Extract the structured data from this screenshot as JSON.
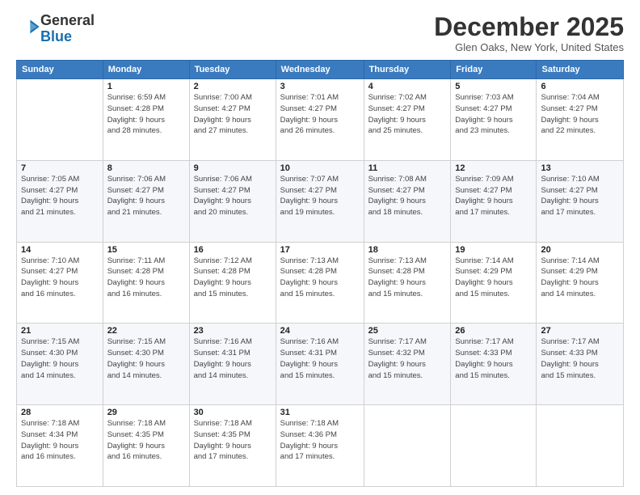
{
  "header": {
    "logo_line1": "General",
    "logo_line2": "Blue",
    "month_title": "December 2025",
    "location": "Glen Oaks, New York, United States"
  },
  "days_of_week": [
    "Sunday",
    "Monday",
    "Tuesday",
    "Wednesday",
    "Thursday",
    "Friday",
    "Saturday"
  ],
  "weeks": [
    [
      {
        "day": "",
        "info": ""
      },
      {
        "day": "1",
        "info": "Sunrise: 6:59 AM\nSunset: 4:28 PM\nDaylight: 9 hours\nand 28 minutes."
      },
      {
        "day": "2",
        "info": "Sunrise: 7:00 AM\nSunset: 4:27 PM\nDaylight: 9 hours\nand 27 minutes."
      },
      {
        "day": "3",
        "info": "Sunrise: 7:01 AM\nSunset: 4:27 PM\nDaylight: 9 hours\nand 26 minutes."
      },
      {
        "day": "4",
        "info": "Sunrise: 7:02 AM\nSunset: 4:27 PM\nDaylight: 9 hours\nand 25 minutes."
      },
      {
        "day": "5",
        "info": "Sunrise: 7:03 AM\nSunset: 4:27 PM\nDaylight: 9 hours\nand 23 minutes."
      },
      {
        "day": "6",
        "info": "Sunrise: 7:04 AM\nSunset: 4:27 PM\nDaylight: 9 hours\nand 22 minutes."
      }
    ],
    [
      {
        "day": "7",
        "info": "Sunrise: 7:05 AM\nSunset: 4:27 PM\nDaylight: 9 hours\nand 21 minutes."
      },
      {
        "day": "8",
        "info": "Sunrise: 7:06 AM\nSunset: 4:27 PM\nDaylight: 9 hours\nand 21 minutes."
      },
      {
        "day": "9",
        "info": "Sunrise: 7:06 AM\nSunset: 4:27 PM\nDaylight: 9 hours\nand 20 minutes."
      },
      {
        "day": "10",
        "info": "Sunrise: 7:07 AM\nSunset: 4:27 PM\nDaylight: 9 hours\nand 19 minutes."
      },
      {
        "day": "11",
        "info": "Sunrise: 7:08 AM\nSunset: 4:27 PM\nDaylight: 9 hours\nand 18 minutes."
      },
      {
        "day": "12",
        "info": "Sunrise: 7:09 AM\nSunset: 4:27 PM\nDaylight: 9 hours\nand 17 minutes."
      },
      {
        "day": "13",
        "info": "Sunrise: 7:10 AM\nSunset: 4:27 PM\nDaylight: 9 hours\nand 17 minutes."
      }
    ],
    [
      {
        "day": "14",
        "info": "Sunrise: 7:10 AM\nSunset: 4:27 PM\nDaylight: 9 hours\nand 16 minutes."
      },
      {
        "day": "15",
        "info": "Sunrise: 7:11 AM\nSunset: 4:28 PM\nDaylight: 9 hours\nand 16 minutes."
      },
      {
        "day": "16",
        "info": "Sunrise: 7:12 AM\nSunset: 4:28 PM\nDaylight: 9 hours\nand 15 minutes."
      },
      {
        "day": "17",
        "info": "Sunrise: 7:13 AM\nSunset: 4:28 PM\nDaylight: 9 hours\nand 15 minutes."
      },
      {
        "day": "18",
        "info": "Sunrise: 7:13 AM\nSunset: 4:28 PM\nDaylight: 9 hours\nand 15 minutes."
      },
      {
        "day": "19",
        "info": "Sunrise: 7:14 AM\nSunset: 4:29 PM\nDaylight: 9 hours\nand 15 minutes."
      },
      {
        "day": "20",
        "info": "Sunrise: 7:14 AM\nSunset: 4:29 PM\nDaylight: 9 hours\nand 14 minutes."
      }
    ],
    [
      {
        "day": "21",
        "info": "Sunrise: 7:15 AM\nSunset: 4:30 PM\nDaylight: 9 hours\nand 14 minutes."
      },
      {
        "day": "22",
        "info": "Sunrise: 7:15 AM\nSunset: 4:30 PM\nDaylight: 9 hours\nand 14 minutes."
      },
      {
        "day": "23",
        "info": "Sunrise: 7:16 AM\nSunset: 4:31 PM\nDaylight: 9 hours\nand 14 minutes."
      },
      {
        "day": "24",
        "info": "Sunrise: 7:16 AM\nSunset: 4:31 PM\nDaylight: 9 hours\nand 15 minutes."
      },
      {
        "day": "25",
        "info": "Sunrise: 7:17 AM\nSunset: 4:32 PM\nDaylight: 9 hours\nand 15 minutes."
      },
      {
        "day": "26",
        "info": "Sunrise: 7:17 AM\nSunset: 4:33 PM\nDaylight: 9 hours\nand 15 minutes."
      },
      {
        "day": "27",
        "info": "Sunrise: 7:17 AM\nSunset: 4:33 PM\nDaylight: 9 hours\nand 15 minutes."
      }
    ],
    [
      {
        "day": "28",
        "info": "Sunrise: 7:18 AM\nSunset: 4:34 PM\nDaylight: 9 hours\nand 16 minutes."
      },
      {
        "day": "29",
        "info": "Sunrise: 7:18 AM\nSunset: 4:35 PM\nDaylight: 9 hours\nand 16 minutes."
      },
      {
        "day": "30",
        "info": "Sunrise: 7:18 AM\nSunset: 4:35 PM\nDaylight: 9 hours\nand 17 minutes."
      },
      {
        "day": "31",
        "info": "Sunrise: 7:18 AM\nSunset: 4:36 PM\nDaylight: 9 hours\nand 17 minutes."
      },
      {
        "day": "",
        "info": ""
      },
      {
        "day": "",
        "info": ""
      },
      {
        "day": "",
        "info": ""
      }
    ]
  ]
}
